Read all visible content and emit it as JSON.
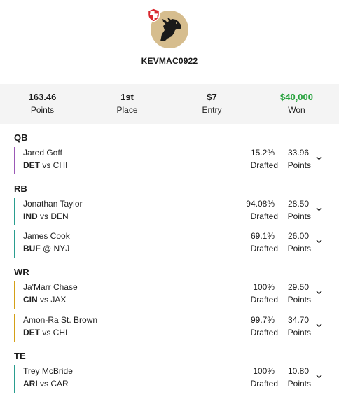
{
  "user": {
    "username": "KEVMAC0922"
  },
  "stats": [
    {
      "value": "163.46",
      "label": "Points"
    },
    {
      "value": "1st",
      "label": "Place"
    },
    {
      "value": "$7",
      "label": "Entry"
    },
    {
      "value": "$40,000",
      "label": "Won"
    }
  ],
  "colors": {
    "won": "#27a23d",
    "qb": "#9b59b6",
    "rb": "#2a9d8f",
    "wr": "#d4a017",
    "te": "#2a9d8f"
  },
  "roster": {
    "qb": {
      "heading": "QB",
      "players": [
        {
          "name": "Jared Goff",
          "team": "DET",
          "matchup": "vs CHI",
          "drafted": "15.2%",
          "drafted_label": "Drafted",
          "points": "33.96",
          "points_label": "Points"
        }
      ]
    },
    "rb": {
      "heading": "RB",
      "players": [
        {
          "name": "Jonathan Taylor",
          "team": "IND",
          "matchup": "vs DEN",
          "drafted": "94.08%",
          "drafted_label": "Drafted",
          "points": "28.50",
          "points_label": "Points"
        },
        {
          "name": "James Cook",
          "team": "BUF",
          "matchup": "@ NYJ",
          "drafted": "69.1%",
          "drafted_label": "Drafted",
          "points": "26.00",
          "points_label": "Points"
        }
      ]
    },
    "wr": {
      "heading": "WR",
      "players": [
        {
          "name": "Ja'Marr Chase",
          "team": "CIN",
          "matchup": "vs JAX",
          "drafted": "100%",
          "drafted_label": "Drafted",
          "points": "29.50",
          "points_label": "Points"
        },
        {
          "name": "Amon-Ra St. Brown",
          "team": "DET",
          "matchup": "vs CHI",
          "drafted": "99.7%",
          "drafted_label": "Drafted",
          "points": "34.70",
          "points_label": "Points"
        }
      ]
    },
    "te": {
      "heading": "TE",
      "players": [
        {
          "name": "Trey McBride",
          "team": "ARI",
          "matchup": "vs CAR",
          "drafted": "100%",
          "drafted_label": "Drafted",
          "points": "10.80",
          "points_label": "Points"
        }
      ]
    }
  }
}
